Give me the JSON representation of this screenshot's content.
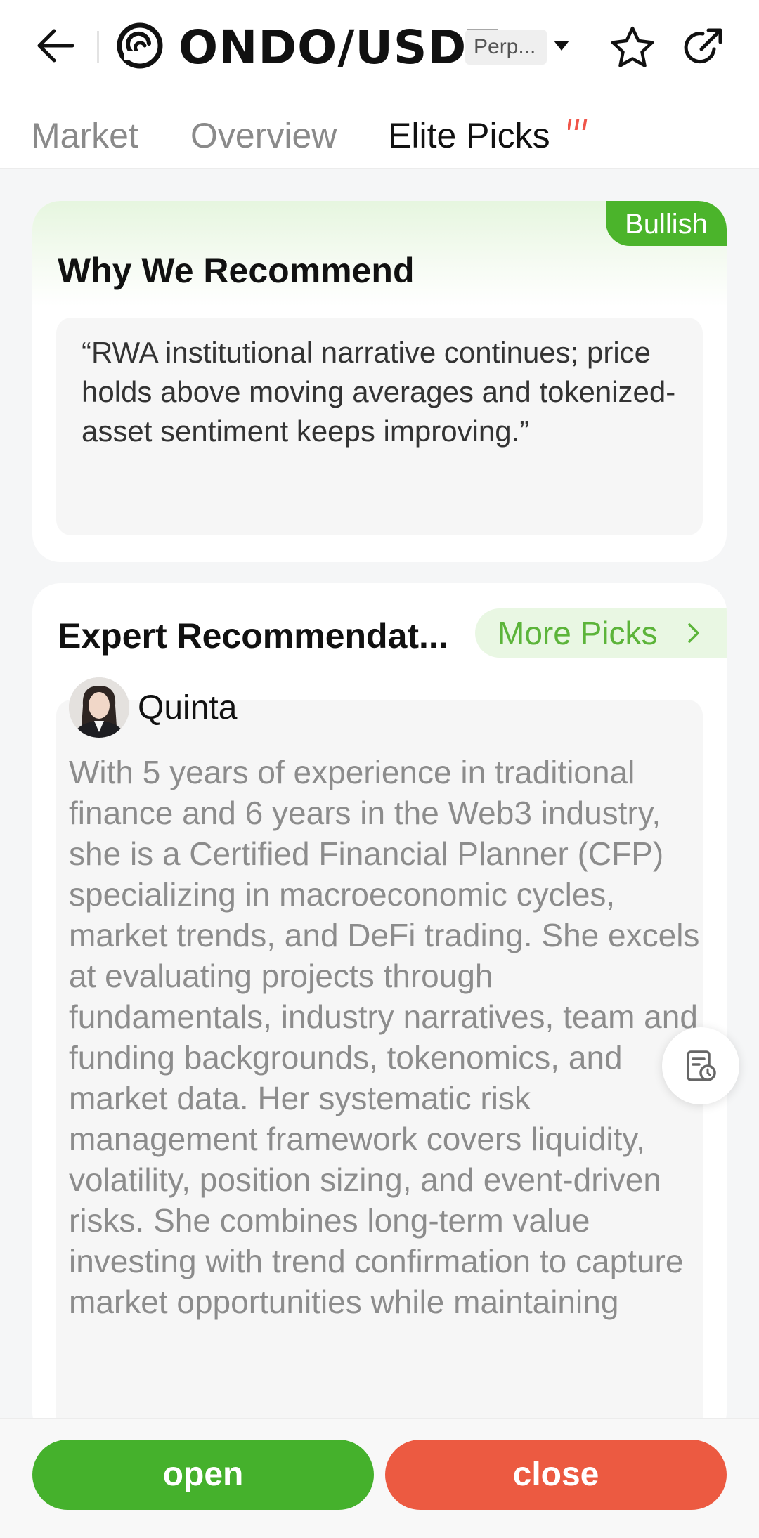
{
  "header": {
    "pair": "ONDO/USDT",
    "contract_type": "Perp...",
    "icons": {
      "back": "back-arrow-icon",
      "logo": "ondo-logo-icon",
      "caret": "caret-down-icon",
      "favorite": "star-icon",
      "share": "share-icon"
    }
  },
  "tabs": [
    {
      "label": "Market",
      "active": false
    },
    {
      "label": "Overview",
      "active": false
    },
    {
      "label": "Elite Picks",
      "active": true
    }
  ],
  "why_card": {
    "sentiment_tag": "Bullish",
    "title": "Why We Recommend",
    "quote": "“RWA institutional narrative continues; price holds above moving averages and tokenized-asset sentiment keeps improving.”"
  },
  "expert_card": {
    "title": "Expert Recommendat...",
    "more_picks_label": "More Picks",
    "expert_name": "Quinta",
    "bio": "With 5 years of experience in traditional finance and 6 years in the Web3 industry, she is a Certified Financial Planner (CFP) specializing in macroeconomic cycles, market trends, and DeFi trading. She excels at evaluating projects through fundamentals, industry narratives, team and funding backgrounds, tokenomics, and market data. Her systematic risk management framework covers liquidity, volatility, position sizing, and event-driven risks. She combines long-term value investing with trend confirmation to capture market opportunities while maintaining"
  },
  "floating_button": {
    "icon": "order-history-icon"
  },
  "actions": {
    "open_label": "open",
    "close_label": "close"
  },
  "colors": {
    "bullish_green": "#4bb42b",
    "open_green": "#45b12c",
    "close_red": "#ec5a41",
    "more_picks_text": "#5cb43a",
    "hot_red": "#f0554a"
  }
}
